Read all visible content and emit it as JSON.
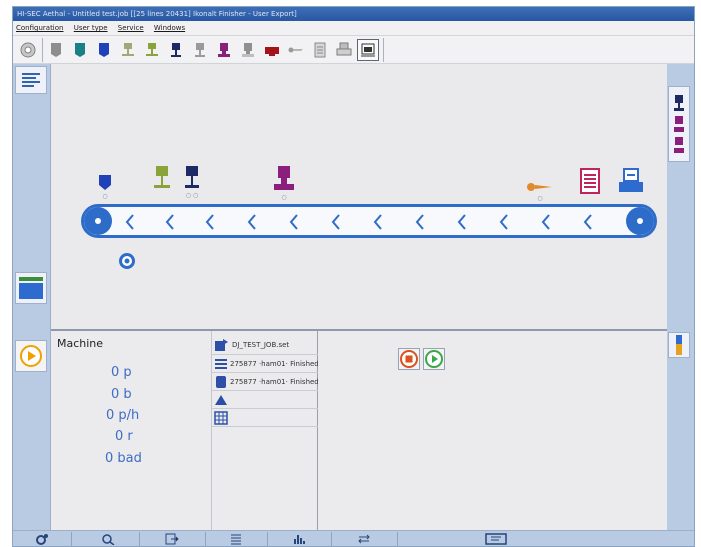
{
  "window": {
    "title": "HI-SEC Aethal - Untitled test.job [[25 lines 20431] Ikonalt Finisher - User Export]"
  },
  "menu": [
    {
      "label": "Configuration"
    },
    {
      "label": "User type"
    },
    {
      "label": "Service"
    },
    {
      "label": "Windows"
    }
  ],
  "machine": {
    "title": "Machine",
    "stats": [
      "0 p",
      "0 b",
      "0 p/h",
      "0 r",
      "0 bad"
    ]
  },
  "jobs": {
    "job_file": "DJ_TEST_JOB.set",
    "input_1": "275877 ·ham01· Finished",
    "input_2": "275877 ·ham01· Finished"
  },
  "colors": {
    "accent": "#2e6cc9",
    "panel_rail": "#b9cbe3",
    "stop": "#d9531e",
    "play": "#3aa84a"
  },
  "icons": {
    "toolbar": [
      "reset-icon",
      "gray-feeder-icon",
      "teal-feeder-icon",
      "blue-feeder-icon",
      "olive-stacker-icon",
      "green-stacker-icon",
      "navy-station-icon",
      "gray-station-icon",
      "purple-station-icon",
      "gray-printer-icon",
      "red-module-icon",
      "knife-icon",
      "document-icon",
      "printer-icon",
      "output-icon"
    ],
    "status": [
      "settings-icon",
      "search-icon",
      "export-icon",
      "list-icon",
      "chart-icon",
      "transfer-icon",
      "screen-icon"
    ]
  }
}
